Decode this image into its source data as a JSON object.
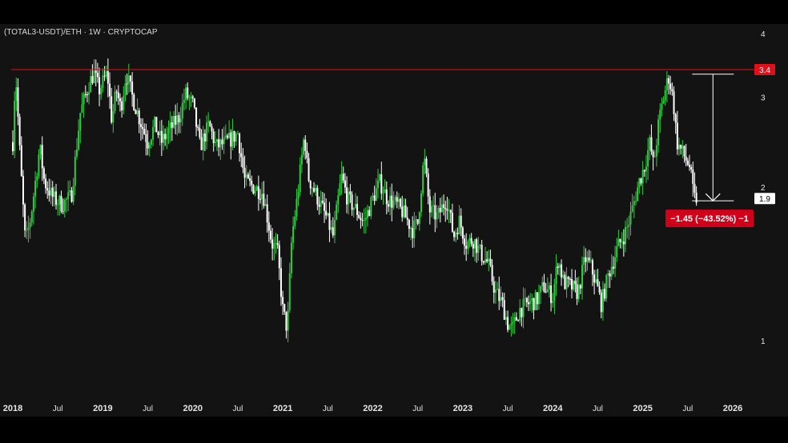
{
  "header": {
    "symbol_title": "(TOTAL3-USDT)/ETH · 1W · CRYPTOCAP"
  },
  "colors": {
    "background": "#131313",
    "up_candle": "#2ecc40",
    "down_candle": "#ffffff",
    "resistance_line": "#e0101a",
    "price_tag_bg": "#e0101a",
    "current_tag_bg": "#ffffff",
    "measure_bg": "#d1001a",
    "axis_text": "#e6e6e6"
  },
  "chart_data": {
    "type": "candlestick",
    "title": "(TOTAL3-USDT)/ETH · 1W · CRYPTOCAP",
    "scale": "log",
    "ylim": [
      0.75,
      4.2
    ],
    "y_ticks": [
      "4",
      "3",
      "2",
      "1"
    ],
    "x_ticks": [
      "2018",
      "Jul",
      "2019",
      "Jul",
      "2020",
      "Jul",
      "2021",
      "Jul",
      "2022",
      "Jul",
      "2023",
      "Jul",
      "2024",
      "Jul",
      "2025",
      "Jul",
      "2026"
    ],
    "xlim_years": [
      2018.0,
      2026.1
    ],
    "resistance_level": "3.4",
    "current_price": "1.9",
    "measure": {
      "label": "−1.45 (−43.52%) −1",
      "from_value": 3.33,
      "to_value": 1.88,
      "x_year": 2025.78
    },
    "price_path": [
      [
        2018.0,
        2.45
      ],
      [
        2018.03,
        3.4
      ],
      [
        2018.08,
        2.3
      ],
      [
        2018.14,
        1.55
      ],
      [
        2018.2,
        1.75
      ],
      [
        2018.3,
        2.4
      ],
      [
        2018.35,
        2.05
      ],
      [
        2018.45,
        1.9
      ],
      [
        2018.55,
        1.85
      ],
      [
        2018.65,
        1.92
      ],
      [
        2018.75,
        2.8
      ],
      [
        2018.85,
        3.2
      ],
      [
        2018.9,
        3.35
      ],
      [
        2018.96,
        3.1
      ],
      [
        2019.05,
        3.35
      ],
      [
        2019.1,
        2.7
      ],
      [
        2019.15,
        3.1
      ],
      [
        2019.2,
        2.85
      ],
      [
        2019.26,
        3.35
      ],
      [
        2019.33,
        3.0
      ],
      [
        2019.4,
        2.75
      ],
      [
        2019.5,
        2.45
      ],
      [
        2019.58,
        2.65
      ],
      [
        2019.65,
        2.45
      ],
      [
        2019.75,
        2.6
      ],
      [
        2019.85,
        2.75
      ],
      [
        2019.92,
        3.05
      ],
      [
        2020.0,
        2.9
      ],
      [
        2020.08,
        2.4
      ],
      [
        2020.18,
        2.65
      ],
      [
        2020.26,
        2.4
      ],
      [
        2020.38,
        2.45
      ],
      [
        2020.5,
        2.55
      ],
      [
        2020.58,
        2.05
      ],
      [
        2020.68,
        2.0
      ],
      [
        2020.78,
        1.95
      ],
      [
        2020.88,
        1.55
      ],
      [
        2020.94,
        1.5
      ],
      [
        2021.0,
        1.15
      ],
      [
        2021.05,
        1.05
      ],
      [
        2021.1,
        1.6
      ],
      [
        2021.16,
        1.9
      ],
      [
        2021.24,
        2.55
      ],
      [
        2021.28,
        2.1
      ],
      [
        2021.36,
        1.95
      ],
      [
        2021.48,
        1.75
      ],
      [
        2021.56,
        1.6
      ],
      [
        2021.65,
        2.1
      ],
      [
        2021.72,
        1.9
      ],
      [
        2021.82,
        1.8
      ],
      [
        2021.9,
        1.7
      ],
      [
        2022.0,
        1.9
      ],
      [
        2022.08,
        2.05
      ],
      [
        2022.16,
        1.9
      ],
      [
        2022.26,
        1.85
      ],
      [
        2022.34,
        1.78
      ],
      [
        2022.44,
        1.65
      ],
      [
        2022.5,
        1.7
      ],
      [
        2022.57,
        2.3
      ],
      [
        2022.63,
        1.8
      ],
      [
        2022.72,
        1.75
      ],
      [
        2022.82,
        1.9
      ],
      [
        2022.9,
        1.6
      ],
      [
        2022.96,
        1.72
      ],
      [
        2023.04,
        1.55
      ],
      [
        2023.12,
        1.58
      ],
      [
        2023.2,
        1.48
      ],
      [
        2023.28,
        1.42
      ],
      [
        2023.36,
        1.25
      ],
      [
        2023.44,
        1.18
      ],
      [
        2023.5,
        1.08
      ],
      [
        2023.55,
        1.05
      ],
      [
        2023.63,
        1.15
      ],
      [
        2023.72,
        1.18
      ],
      [
        2023.82,
        1.2
      ],
      [
        2023.9,
        1.28
      ],
      [
        2024.0,
        1.22
      ],
      [
        2024.06,
        1.45
      ],
      [
        2024.12,
        1.3
      ],
      [
        2024.2,
        1.28
      ],
      [
        2024.28,
        1.24
      ],
      [
        2024.36,
        1.45
      ],
      [
        2024.42,
        1.4
      ],
      [
        2024.48,
        1.3
      ],
      [
        2024.54,
        1.18
      ],
      [
        2024.62,
        1.35
      ],
      [
        2024.72,
        1.52
      ],
      [
        2024.82,
        1.65
      ],
      [
        2024.88,
        1.8
      ],
      [
        2024.96,
        2.05
      ],
      [
        2025.02,
        2.2
      ],
      [
        2025.08,
        2.45
      ],
      [
        2025.12,
        2.2
      ],
      [
        2025.18,
        2.7
      ],
      [
        2025.24,
        3.05
      ],
      [
        2025.29,
        3.3
      ],
      [
        2025.34,
        2.95
      ],
      [
        2025.38,
        2.45
      ],
      [
        2025.46,
        2.3
      ],
      [
        2025.52,
        2.2
      ],
      [
        2025.57,
        1.9
      ],
      [
        2025.6,
        1.9
      ]
    ]
  }
}
